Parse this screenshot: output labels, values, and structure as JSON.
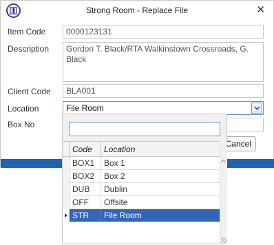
{
  "window": {
    "title": "Strong Room - Replace File",
    "close_glyph": "✕"
  },
  "form": {
    "item_code": {
      "label": "Item Code",
      "value": "0000123131"
    },
    "description": {
      "label": "Description",
      "value": "Gordon T. Black/RTA Walkinstown Crossroads, G. Black"
    },
    "client_code": {
      "label": "Client Code",
      "value": "BLA001"
    },
    "location": {
      "label": "Location",
      "value": "File Room"
    },
    "box_no": {
      "label": "Box No",
      "value": ""
    }
  },
  "buttons": {
    "cancel_label": "Cancel"
  },
  "dropdown": {
    "search_value": "",
    "columns": [
      "Code",
      "Location"
    ],
    "rows": [
      {
        "code": "BOX1",
        "location": "Box 1"
      },
      {
        "code": "BOX2",
        "location": "Box 2"
      },
      {
        "code": "DUB",
        "location": "Dublin"
      },
      {
        "code": "OFF",
        "location": "Offsite"
      },
      {
        "code": "STR",
        "location": "File Room"
      }
    ],
    "selected_code": "STR"
  },
  "colors": {
    "accent": "#1e63b7",
    "selected_row": "#3366b8",
    "focus_border": "#6b8fc7"
  },
  "icons": {
    "app": "vault-icon",
    "close": "close-icon",
    "combo": "chevron-down-icon",
    "row_pointer": "row-pointer-icon",
    "scroll_up": "chevron-up-icon",
    "resize": "resize-grip-icon"
  }
}
